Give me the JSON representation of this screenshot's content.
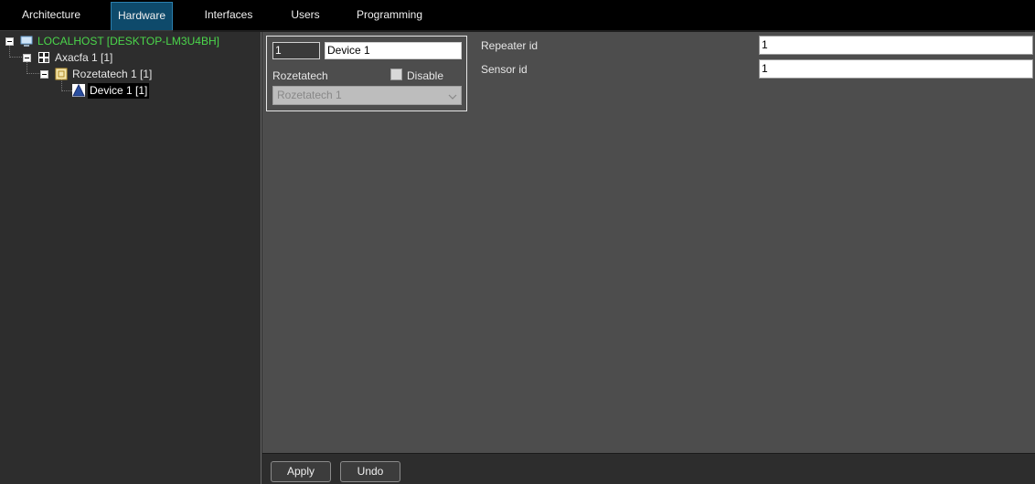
{
  "tabs": [
    {
      "label": "Architecture",
      "active": false
    },
    {
      "label": "Hardware",
      "active": true
    },
    {
      "label": "Interfaces",
      "active": false
    },
    {
      "label": "Users",
      "active": false
    },
    {
      "label": "Programming",
      "active": false
    }
  ],
  "tree": {
    "root": {
      "label": "LOCALHOST [DESKTOP-LM3U4BH]",
      "icon": "computer-icon",
      "color": "#4bd64b"
    },
    "level1": {
      "label": "Axacfa 1 [1]",
      "icon": "grid-device-icon"
    },
    "level2": {
      "label": "Rozetatech 1 [1]",
      "icon": "folder-device-icon"
    },
    "level3": {
      "label": "Device 1 [1]",
      "icon": "triangle-sensor-icon",
      "selected": true
    }
  },
  "device_box": {
    "number_value": "1",
    "name_value": "Device 1",
    "parent_label": "Rozetatech",
    "disable_label": "Disable",
    "disable_checked": false,
    "parent_select_value": "Rozetatech 1"
  },
  "fields": {
    "repeater_label": "Repeater id",
    "repeater_value": "1",
    "sensor_label": "Sensor id",
    "sensor_value": "1"
  },
  "buttons": {
    "apply_label": "Apply",
    "undo_label": "Undo"
  },
  "colors": {
    "active_tab": "#0e4a6b",
    "content_bg": "#4d4d4d",
    "tree_bg": "#2d2d2d",
    "root_text": "#4bd64b"
  }
}
